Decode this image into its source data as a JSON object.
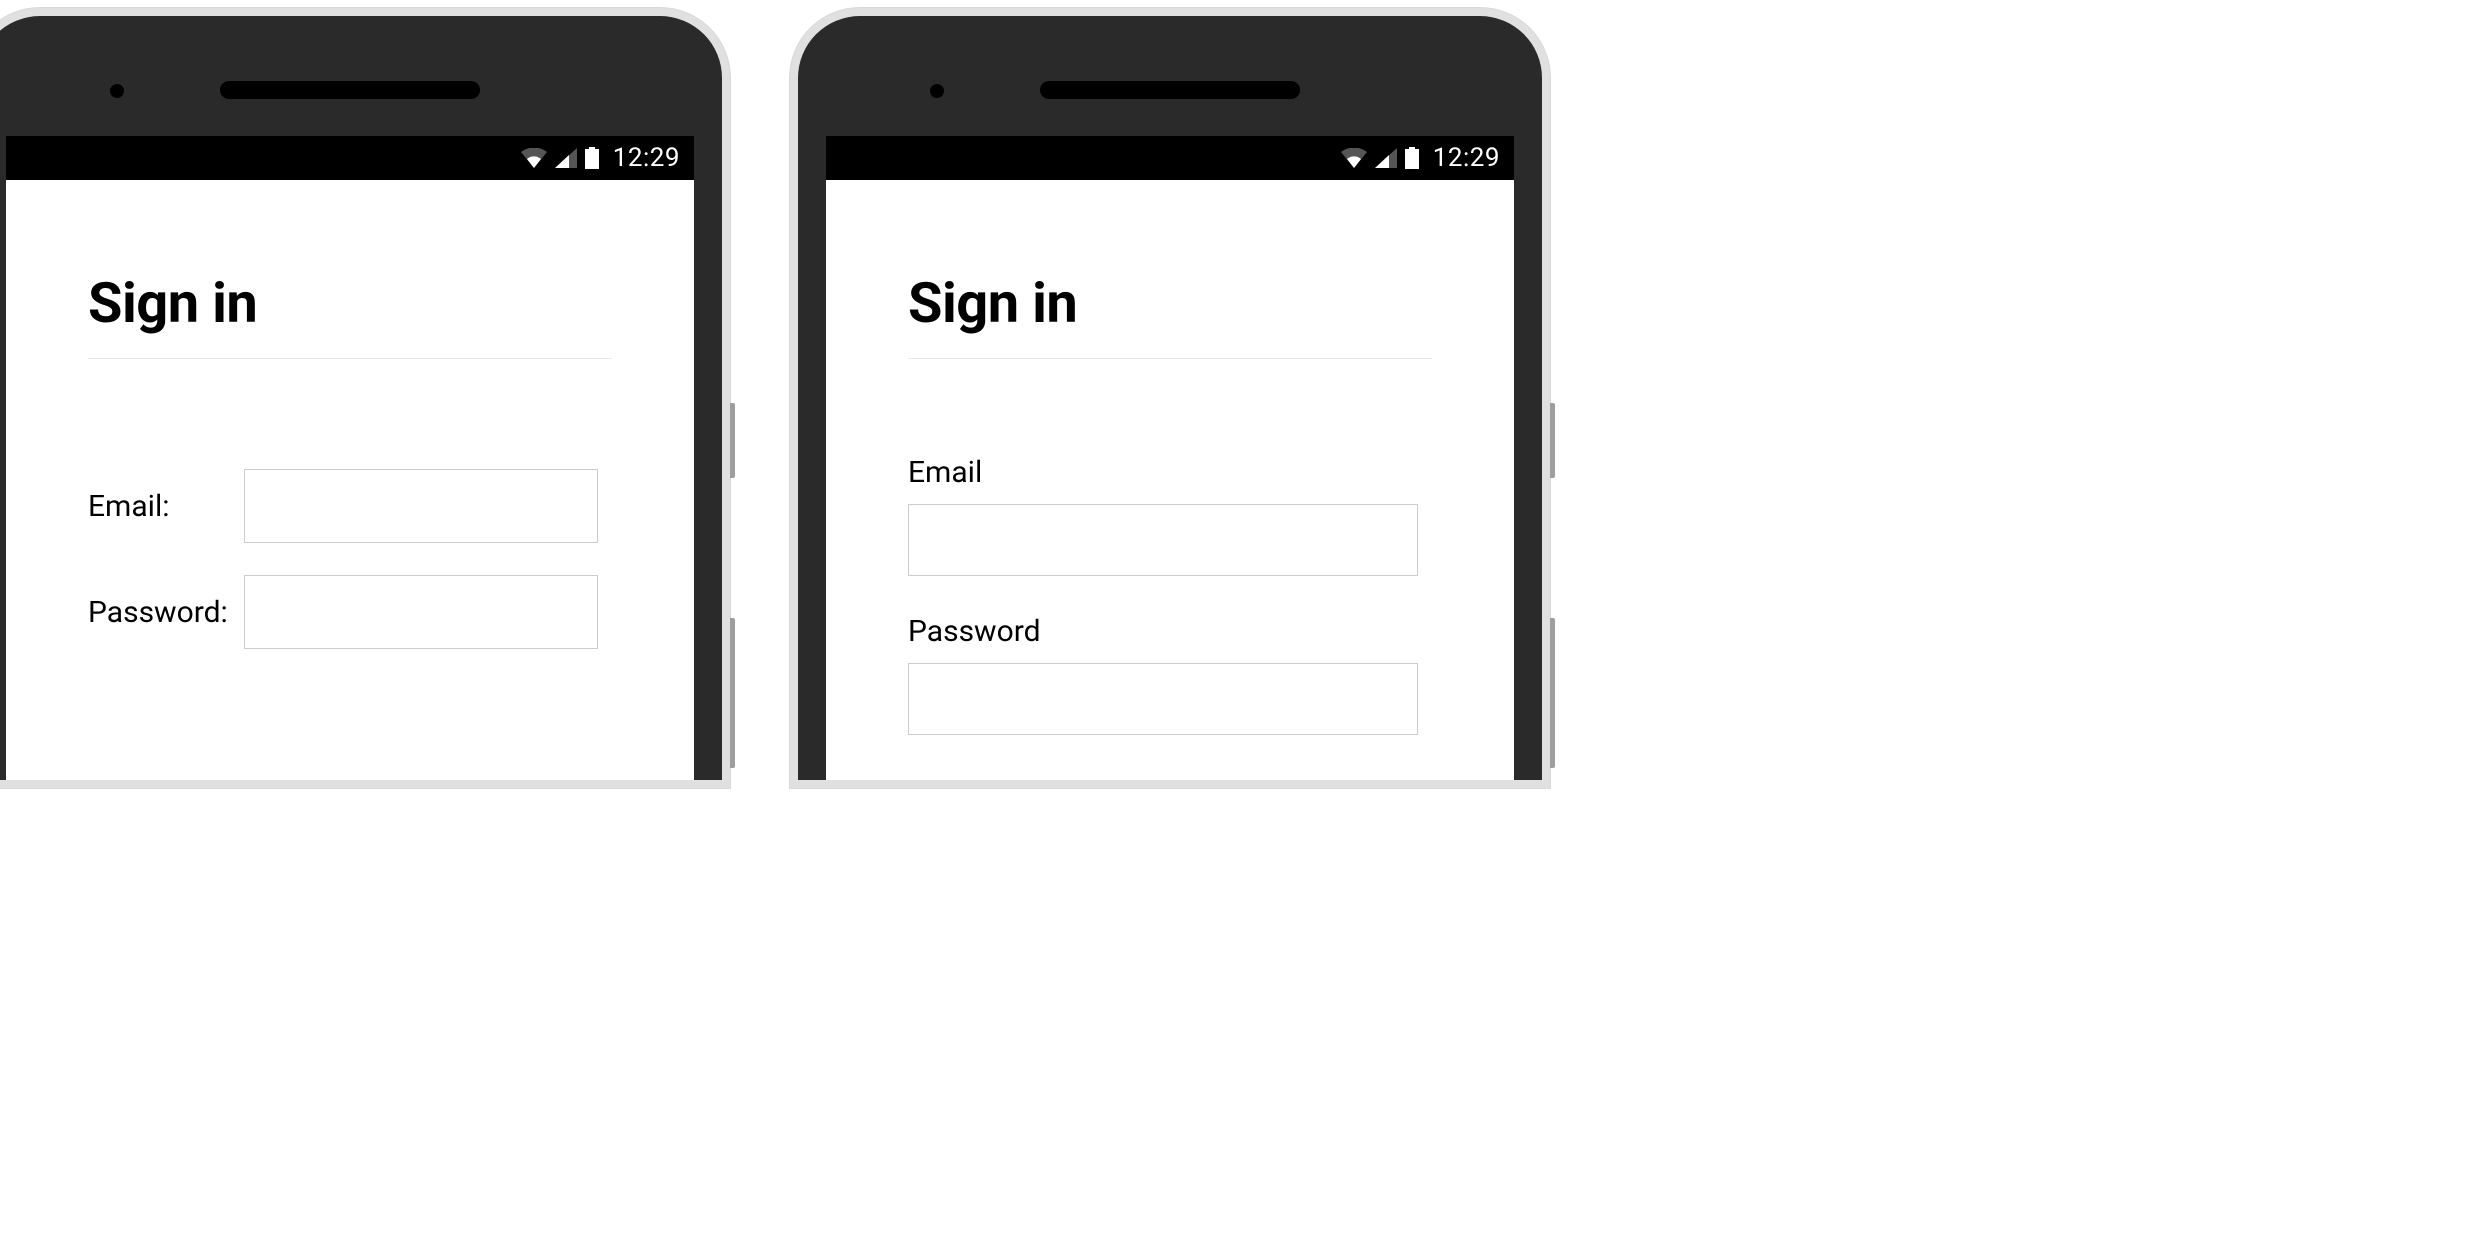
{
  "status": {
    "time": "12:29"
  },
  "left": {
    "title": "Sign in",
    "form": {
      "email_label": "Email:",
      "email_value": "",
      "password_label": "Password:",
      "password_value": ""
    }
  },
  "right": {
    "title": "Sign in",
    "form": {
      "email_label": "Email",
      "email_value": "",
      "password_label": "Password",
      "password_value": ""
    }
  }
}
